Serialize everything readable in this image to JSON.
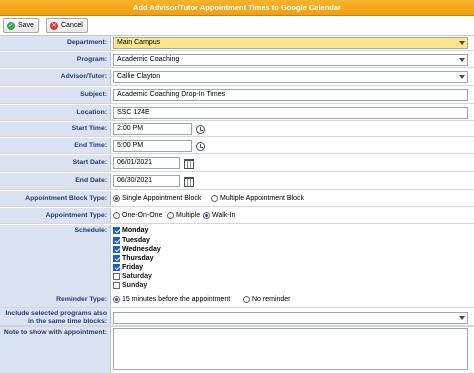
{
  "window": {
    "title": "Add Advisor/Tutor Appointment Times to Google Calendar"
  },
  "toolbar": {
    "save_label": "Save",
    "cancel_label": "Cancel"
  },
  "labels": {
    "department": "Department:",
    "program": "Program:",
    "advisor": "Advisor/Tutor:",
    "subject": "Subject:",
    "location": "Location:",
    "start_time": "Start Time:",
    "end_time": "End Time:",
    "start_date": "Start Date:",
    "end_date": "End Date:",
    "block_type": "Appointment Block Type:",
    "appt_type": "Appointment Type:",
    "schedule": "Schedule:",
    "reminder": "Reminder Type:",
    "include_programs_1": "Include selected programs also",
    "include_programs_2": "in the same time blocks:",
    "note": "Note to show with appointment:"
  },
  "values": {
    "department": "Main Campus",
    "program": "Academic Coaching",
    "advisor": "Callie Clayton",
    "subject": "Academic Coaching Drop-In Times",
    "location": "SSC 124E",
    "start_time": "2:00 PM",
    "end_time": "5:00 PM",
    "start_date": "06/01/2021",
    "end_date": "06/30/2021",
    "include_programs": "",
    "note": ""
  },
  "block_type_options": [
    {
      "label": "Single Appointment Block",
      "selected": true
    },
    {
      "label": "Multiple Appointment Block",
      "selected": false
    }
  ],
  "appt_type_options": [
    {
      "label": "One-On-One",
      "selected": false
    },
    {
      "label": "Multiple",
      "selected": false
    },
    {
      "label": "Walk-In",
      "selected": true
    }
  ],
  "schedule": [
    {
      "day": "Monday",
      "checked": true
    },
    {
      "day": "Tuesday",
      "checked": true
    },
    {
      "day": "Wednesday",
      "checked": true
    },
    {
      "day": "Thursday",
      "checked": true
    },
    {
      "day": "Friday",
      "checked": true
    },
    {
      "day": "Saturday",
      "checked": false
    },
    {
      "day": "Sunday",
      "checked": false
    }
  ],
  "reminder_options": [
    {
      "label": "15 minutes before the appointment",
      "selected": true
    },
    {
      "label": "No reminder",
      "selected": false
    }
  ],
  "colors": {
    "title_bar": "#f1a010",
    "label_bg": "#dbe2f1",
    "label_text": "#1f3d7a",
    "highlight": "#fde58a"
  },
  "icons": {
    "save": "save-icon",
    "cancel": "cancel-icon",
    "time": "clock-icon",
    "date": "calendar-icon"
  }
}
